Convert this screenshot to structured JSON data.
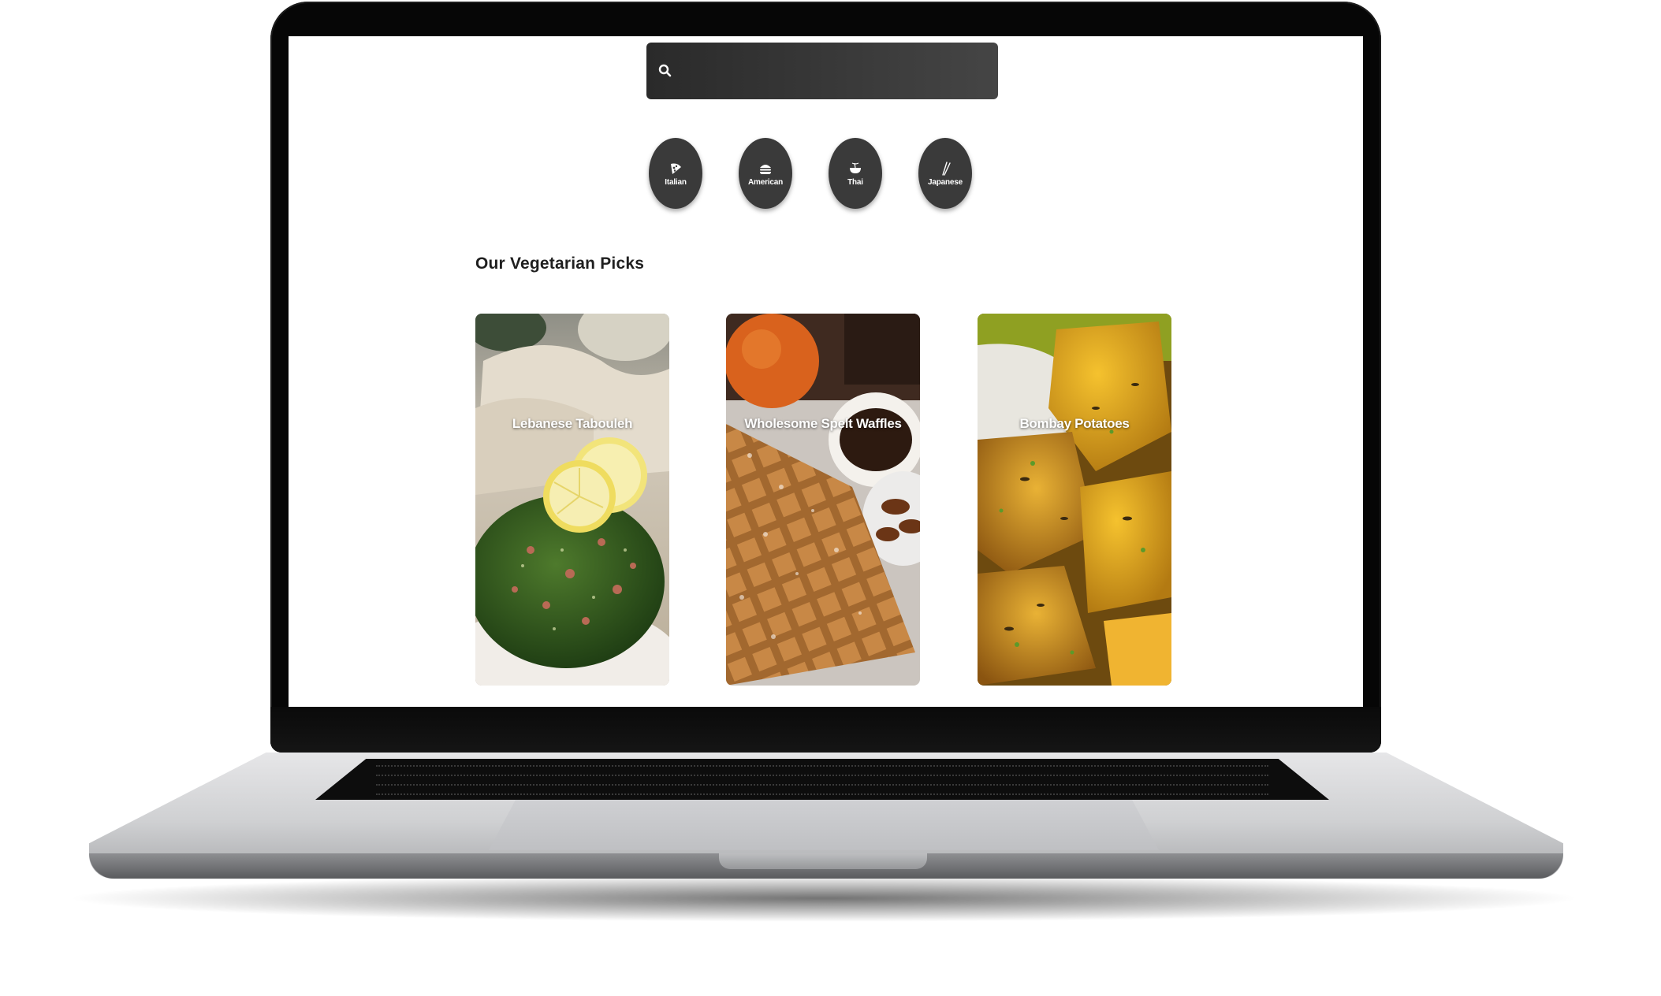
{
  "search": {
    "placeholder": "",
    "icon": "search-icon"
  },
  "cuisines": [
    {
      "label": "Italian",
      "icon": "pizza-slice-icon"
    },
    {
      "label": "American",
      "icon": "hamburger-icon"
    },
    {
      "label": "Thai",
      "icon": "noodle-bowl-icon"
    },
    {
      "label": "Japanese",
      "icon": "chopsticks-icon"
    }
  ],
  "section": {
    "title": "Our Vegetarian Picks"
  },
  "recipes": [
    {
      "title": "Lebanese Tabouleh",
      "image": "tabouleh-photo"
    },
    {
      "title": "Wholesome Spelt Waffles",
      "image": "waffles-photo"
    },
    {
      "title": "Bombay Potatoes",
      "image": "potatoes-photo"
    }
  ],
  "colors": {
    "search_bg": "#3a3a3a",
    "cuisine_bg": "#3a3a3a",
    "title_text": "#1f1f1f",
    "card_text": "#ffffff"
  }
}
